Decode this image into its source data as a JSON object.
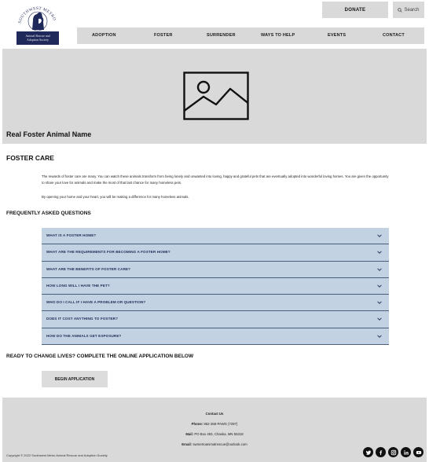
{
  "header": {
    "logo": {
      "arc_text": "SOUTHWEST METRO",
      "banner_line1": "Animal Rescue and",
      "banner_line2": "Adoption Society"
    },
    "donate_label": "DONATE",
    "search_label": "Search",
    "nav": [
      "ADOPTION",
      "FOSTER",
      "SURRENDER",
      "WAYS TO HELP",
      "EVENTS",
      "CONTACT"
    ]
  },
  "hero": {
    "title": "Real Foster Animal Name",
    "image_icon": "image-placeholder-icon"
  },
  "foster_care": {
    "title": "FOSTER CARE",
    "paragraph1": "The rewards of foster care are many. You can watch these animals transform from being lonely and unwanted into loving, happy and grateful pets that are eventually adopted into wonderful loving homes. You are given the opportunity to share your love for animals and make the most of that last chance for many homeless pets.",
    "paragraph2": "By opening your home and your heart, you will be making a difference for many homeless animals."
  },
  "faq": {
    "title": "FREQUENTLY ASKED QUESTIONS",
    "items": [
      "WHAT IS A FOSTER HOME?",
      "WHAT ARE THE REQUIREMENTS FOR BECOMING A FOSTER HOME?",
      "WHAT ARE THE BENEFITS OF FOSTER CARE?",
      "HOW LONG WILL I HAVE THE PET?",
      "WHO DO I CALL IF I HAVE A PROBLEM OR QUESTION?",
      "DOES IT COST ANYTHING TO FOSTER?",
      "HOW DO THE ANIMALS GET EXPOSURE?"
    ]
  },
  "cta": {
    "title": "READY TO CHANGE LIVES? COMPLETE THE ONLINE APPLICATION BELOW",
    "button_label": "BEGIN APPLICATION"
  },
  "footer": {
    "contact_title": "Contact Us",
    "phone_label": "Phone:",
    "phone_value": "952-368-PAWS (7297)",
    "mail_label": "Mail:",
    "mail_value": "PO Box 493, Chaska, MN 55318",
    "email_label": "Email:",
    "email_value": "swmetroanimalrescue@outlook.com",
    "copyright": "Copyright © 2022 Southwest Metro Animal Rescue and Adoption Society",
    "socials": [
      "twitter-icon",
      "facebook-icon",
      "instagram-icon",
      "linkedin-icon",
      "youtube-icon"
    ]
  },
  "colors": {
    "panel_gray": "#d9d9d9",
    "faq_bg": "#c3d2e2",
    "faq_text": "#1e2f57",
    "logo_navy": "#1f2a5a"
  }
}
